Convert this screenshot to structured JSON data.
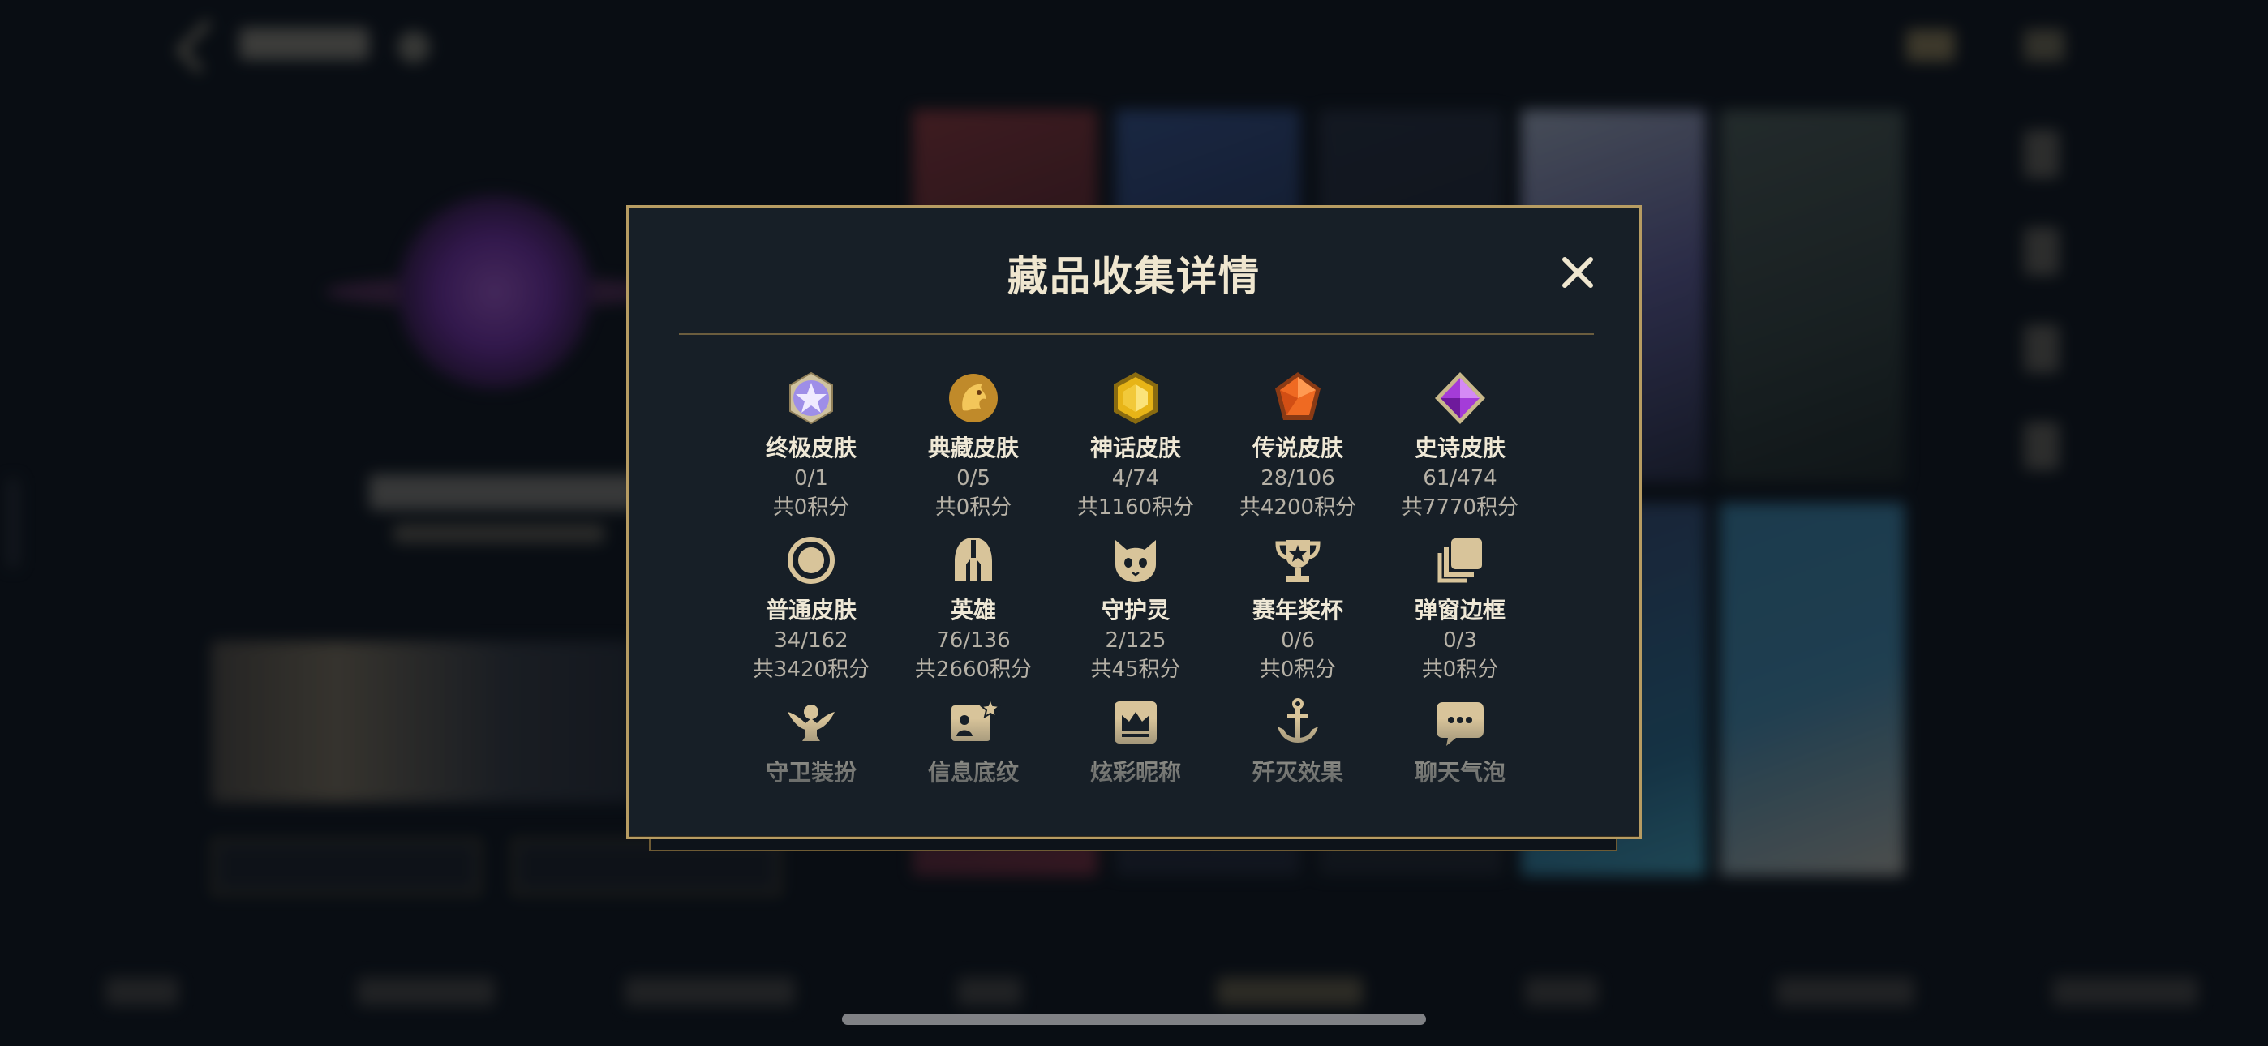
{
  "background": {
    "blurred": true
  },
  "modal": {
    "title": "藏品收集详情",
    "close_icon": "close-icon",
    "categories": [
      {
        "icon": "ultimate-skin-icon",
        "name": "终极皮肤",
        "count": "0/1",
        "points": "共0积分"
      },
      {
        "icon": "collector-skin-icon",
        "name": "典藏皮肤",
        "count": "0/5",
        "points": "共0积分"
      },
      {
        "icon": "mythic-skin-icon",
        "name": "神话皮肤",
        "count": "4/74",
        "points": "共1160积分"
      },
      {
        "icon": "legendary-skin-icon",
        "name": "传说皮肤",
        "count": "28/106",
        "points": "共4200积分"
      },
      {
        "icon": "epic-skin-icon",
        "name": "史诗皮肤",
        "count": "61/474",
        "points": "共7770积分"
      },
      {
        "icon": "normal-skin-icon",
        "name": "普通皮肤",
        "count": "34/162",
        "points": "共3420积分"
      },
      {
        "icon": "champion-helmet-icon",
        "name": "英雄",
        "count": "76/136",
        "points": "共2660积分"
      },
      {
        "icon": "guardian-icon",
        "name": "守护灵",
        "count": "2/125",
        "points": "共45积分"
      },
      {
        "icon": "trophy-icon",
        "name": "赛年奖杯",
        "count": "0/6",
        "points": "共0积分"
      },
      {
        "icon": "frame-icon",
        "name": "弹窗边框",
        "count": "0/3",
        "points": "共0积分"
      },
      {
        "icon": "ward-skin-icon",
        "name": "守卫装扮"
      },
      {
        "icon": "profile-banner-icon",
        "name": "信息底纹"
      },
      {
        "icon": "crown-nickname-icon",
        "name": "炫彩昵称"
      },
      {
        "icon": "anchor-effect-icon",
        "name": "歼灭效果"
      },
      {
        "icon": "chat-bubble-icon",
        "name": "聊天气泡"
      }
    ]
  },
  "colors": {
    "modal_bg": "#171f27",
    "modal_border": "#b79c62",
    "title_text": "#efe6cf",
    "secondary_text": "#b6b1a6",
    "icon_gold": "#d8c49a"
  }
}
